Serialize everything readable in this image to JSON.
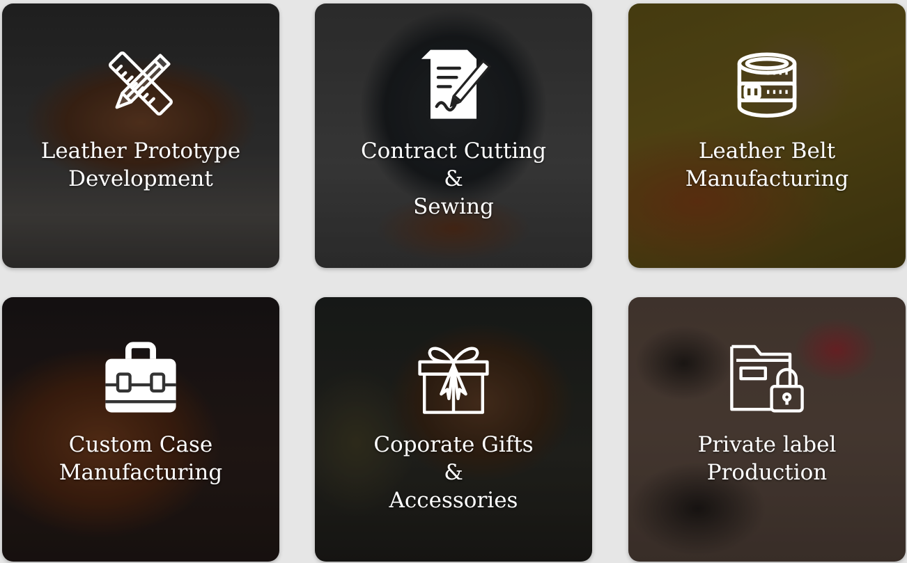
{
  "cards": [
    {
      "title": "Leather Prototype\nDevelopment",
      "icon": "pencil-ruler-icon"
    },
    {
      "title": "Contract Cutting\n&\nSewing",
      "icon": "contract-signing-icon"
    },
    {
      "title": "Leather Belt\nManufacturing",
      "icon": "belt-roll-icon"
    },
    {
      "title": "Custom Case\nManufacturing",
      "icon": "briefcase-icon"
    },
    {
      "title": "Coporate Gifts\n&\nAccessories",
      "icon": "gift-box-icon"
    },
    {
      "title": "Private label\nProduction",
      "icon": "locked-folder-icon"
    }
  ],
  "colors": {
    "page_background": "#e6e6e6",
    "text": "#ffffff"
  }
}
